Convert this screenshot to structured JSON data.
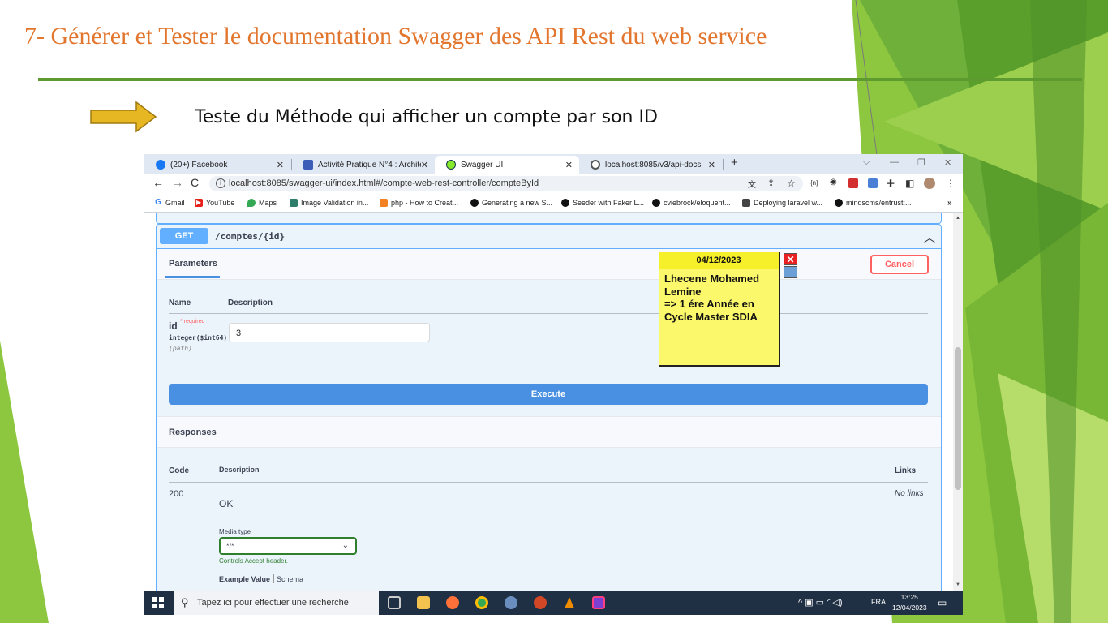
{
  "slide": {
    "title": "7- Générer et Tester le documentation Swagger des API Rest du  web service",
    "subtitle": "Teste du Méthode qui afficher un compte par son ID",
    "colors": {
      "title": "#e2762e",
      "rule": "#5d9a2f",
      "arrow": "#e6b623"
    }
  },
  "browser": {
    "tabs": [
      {
        "label": "(20+) Facebook",
        "icon": "facebook-icon"
      },
      {
        "label": "Activité Pratique N°4 : Architectu",
        "icon": "doc-icon"
      },
      {
        "label": "Swagger UI",
        "icon": "swagger-icon"
      },
      {
        "label": "localhost:8085/v3/api-docs",
        "icon": "globe-icon"
      }
    ],
    "url": "localhost:8085/swagger-ui/index.html#/compte-web-rest-controller/compteById",
    "bookmarks": [
      "Gmail",
      "YouTube",
      "Maps",
      "Image Validation in...",
      "php - How to Creat...",
      "Generating a new S...",
      "Seeder with Faker L...",
      "cviebrock/eloquent...",
      "Deploying laravel w...",
      "mindscms/entrust:..."
    ]
  },
  "swagger": {
    "method": "GET",
    "path": "/comptes/{id}",
    "parameters_tab": "Parameters",
    "cancel_label": "Cancel",
    "col_name": "Name",
    "col_description": "Description",
    "param": {
      "name": "id",
      "required": "* required",
      "type": "integer($int64)",
      "in": "(path)",
      "value": "3"
    },
    "execute_label": "Execute",
    "responses_title": "Responses",
    "resp_col_code": "Code",
    "resp_col_description": "Description",
    "resp_col_links": "Links",
    "response": {
      "code": "200",
      "description": "OK",
      "links": "No links",
      "media_type_label": "Media type",
      "media_type": "*/*",
      "controls_accept": "Controls Accept header.",
      "example_value": "Example Value",
      "schema": "Schema"
    }
  },
  "taskbar": {
    "search_placeholder": "Tapez ici pour effectuer une recherche",
    "language": "FRA",
    "time": "13:25",
    "date": "12/04/2023"
  },
  "sticky_note": {
    "date": "04/12/2023",
    "lines": [
      "Lhecene Mohamed",
      "Lemine",
      "=> 1 ére Année en",
      "Cycle Master SDIA"
    ]
  }
}
